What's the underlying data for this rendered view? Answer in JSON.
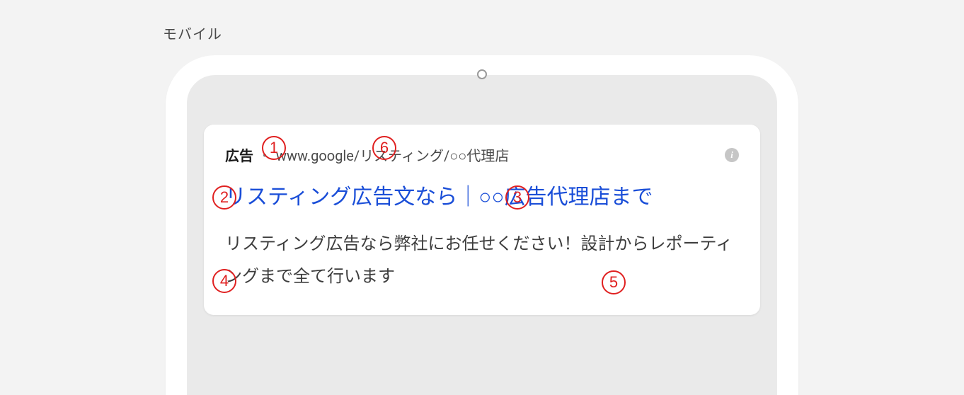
{
  "section_label": "モバイル",
  "ad": {
    "badge": "広告",
    "separator": "・",
    "url": "www.google/リスティング/○○代理店",
    "headline": "リスティング広告文なら｜○○広告代理店まで",
    "description": "リスティング広告なら弊社にお任せください！設計からレポーティングまで全て行います",
    "info_glyph": "i"
  },
  "annotations": {
    "n1": "1",
    "n2": "2",
    "n3": "3",
    "n4": "4",
    "n5": "5",
    "n6": "6"
  }
}
